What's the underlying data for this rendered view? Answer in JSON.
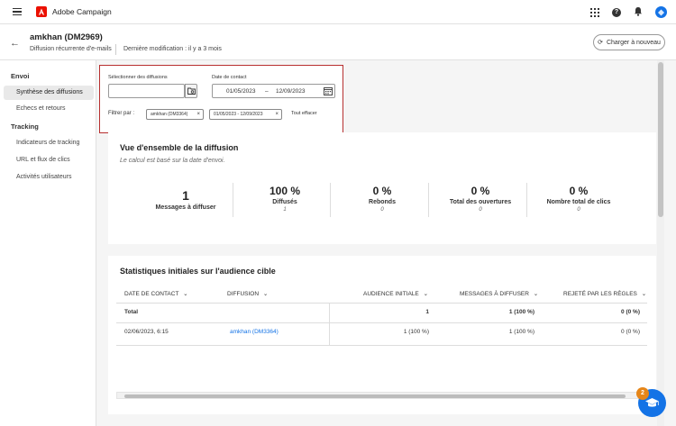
{
  "app": {
    "name": "Adobe Campaign"
  },
  "header": {
    "title": "amkhan (DM2969)",
    "type": "Diffusion récurrente d'e-mails",
    "modified": "Dernière modification : il y a 3 mois",
    "reload_label": "Charger à nouveau"
  },
  "sidebar": {
    "section_envoi": "Envoi",
    "envoi_items": [
      "Synthèse des diffusions",
      "Echecs et retours"
    ],
    "section_tracking": "Tracking",
    "tracking_items": [
      "Indicateurs de tracking",
      "URL et flux de clics",
      "Activités utilisateurs"
    ]
  },
  "filters": {
    "select_label": "Sélectionner des diffusions",
    "select_value": "",
    "date_label": "Date de contact",
    "date_start": "01/05/2023",
    "date_separator": "–",
    "date_end": "12/09/2023",
    "filter_by": "Filtrer par :",
    "chips": [
      "amkhan (DM3364)",
      "01/05/2023 - 12/09/2023"
    ],
    "clear_all": "Tout effacer"
  },
  "overview": {
    "title": "Vue d'ensemble de la diffusion",
    "subtitle": "Le calcul est basé sur la date d'envoi.",
    "kpis": [
      {
        "value": "1",
        "label": "Messages à diffuser",
        "sub": ""
      },
      {
        "value": "100 %",
        "label": "Diffusés",
        "sub": "1"
      },
      {
        "value": "0 %",
        "label": "Rebonds",
        "sub": "0"
      },
      {
        "value": "0 %",
        "label": "Total des ouvertures",
        "sub": "0"
      },
      {
        "value": "0 %",
        "label": "Nombre total de clics",
        "sub": "0"
      }
    ]
  },
  "stats": {
    "title": "Statistiques initiales sur l'audience cible",
    "columns": [
      "DATE DE CONTACT",
      "DIFFUSION",
      "AUDIENCE INITIALE",
      "MESSAGES À DIFFUSER",
      "REJETÉ PAR LES RÈGLES"
    ],
    "total_row": [
      "Total",
      "",
      "1",
      "1 (100 %)",
      "0 (0 %)"
    ],
    "rows": [
      [
        "02/06/2023, 6:15",
        "amkhan (DM3364)",
        "1 (100 %)",
        "1 (100 %)",
        "0 (0 %)"
      ]
    ]
  },
  "fab": {
    "badge": "2"
  },
  "colors": {
    "accent": "#1473e6",
    "brand_red": "#eb1000",
    "highlight_border": "#b72f2f",
    "badge": "#e68619"
  }
}
